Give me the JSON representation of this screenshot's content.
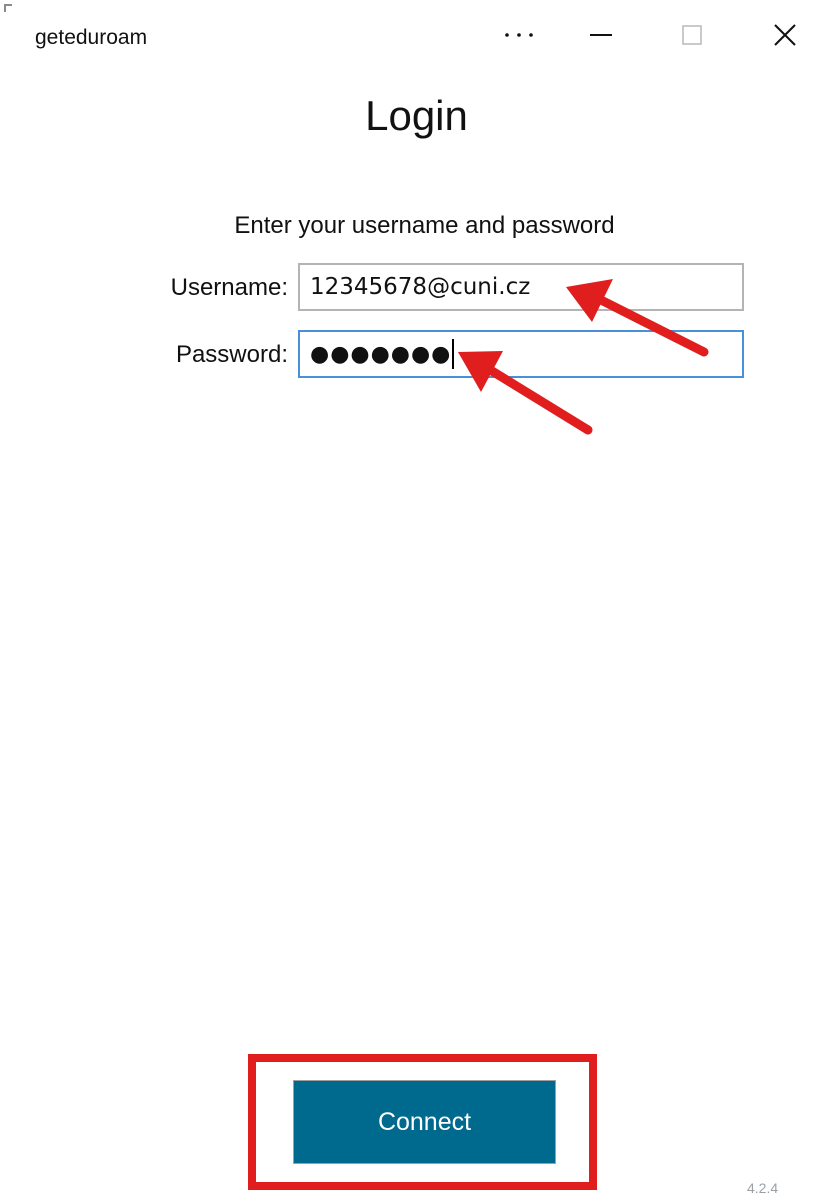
{
  "window": {
    "title": "geteduroam",
    "more_label": "...",
    "controls": [
      "more",
      "minimize",
      "maximize",
      "close"
    ]
  },
  "page": {
    "title": "Login",
    "instructions": "Enter your username and password"
  },
  "form": {
    "username_label": "Username:",
    "username_value": "12345678@cuni.cz",
    "password_label": "Password:",
    "password_masked": "●●●●●●●"
  },
  "actions": {
    "connect_label": "Connect"
  },
  "footer": {
    "version": "4.2.4"
  },
  "colors": {
    "connect_button": "#006a8e",
    "annotation_red": "#e01e1e",
    "focused_border": "#4a90d9"
  }
}
